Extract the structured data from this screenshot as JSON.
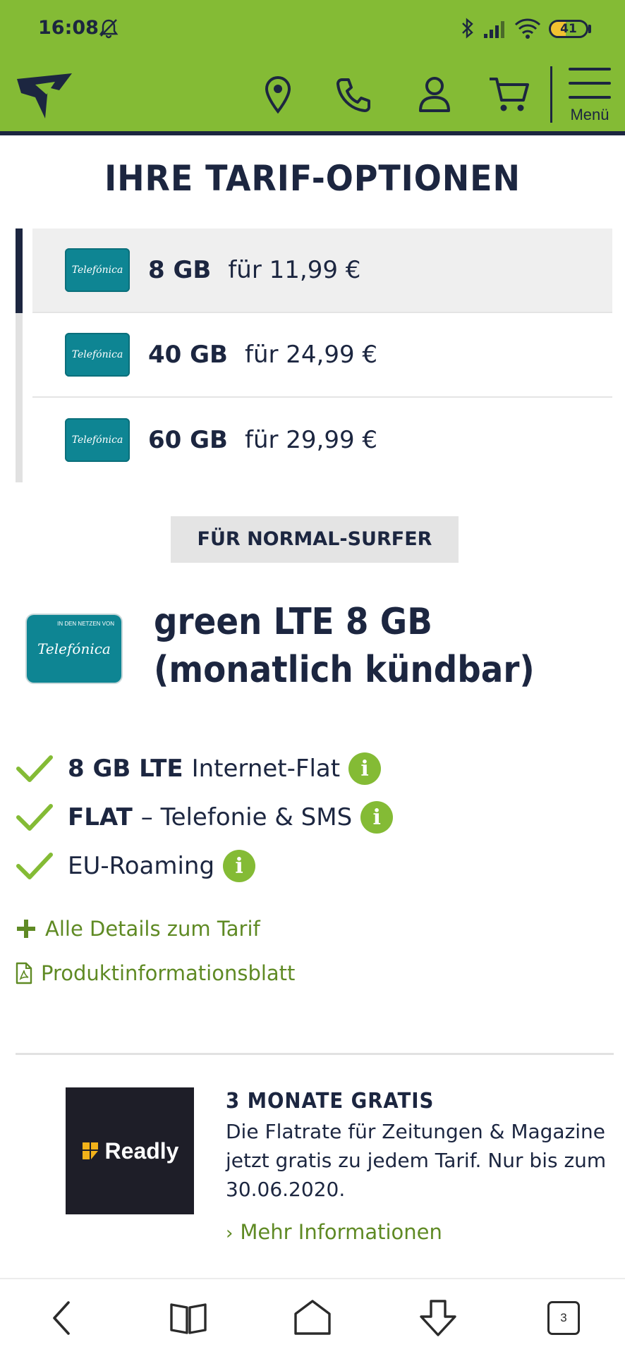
{
  "status_bar": {
    "time": "16:08",
    "battery_level": "41",
    "battery_fraction": 0.41,
    "icons": [
      "bell-muted-icon",
      "bluetooth-icon",
      "signal-icon",
      "wifi-icon",
      "battery-icon"
    ]
  },
  "header": {
    "brand_color": "#84bb35",
    "dark_color": "#1c2640",
    "menu_label": "Menü",
    "icons": [
      "location-icon",
      "phone-icon",
      "user-icon",
      "cart-icon",
      "menu-icon"
    ]
  },
  "section_title": "IHRE TARIF-OPTIONEN",
  "options": [
    {
      "badge": "Telefónica",
      "gb": "8 GB",
      "price": "für 11,99 €",
      "selected": true
    },
    {
      "badge": "Telefónica",
      "gb": "40 GB",
      "price": "für 24,99 €",
      "selected": false
    },
    {
      "badge": "Telefónica",
      "gb": "60 GB",
      "price": "für 29,99 €",
      "selected": false
    }
  ],
  "surfer_label": "FÜR NORMAL-SURFER",
  "product": {
    "logo_small": "IN DEN NETZEN VON",
    "logo_big": "Telefónica",
    "title_line1": "green LTE 8 GB",
    "title_line2": "(monatlich kündbar)"
  },
  "features": [
    {
      "bold": "8 GB LTE",
      "text": "Internet-Flat"
    },
    {
      "bold": "FLAT",
      "text": "– Telefonie & SMS"
    },
    {
      "bold": "",
      "text": "EU-Roaming"
    }
  ],
  "links": {
    "details": "Alle Details zum Tarif",
    "pib": "Produktinformationsblatt"
  },
  "promo": {
    "logo_text": "Readly",
    "title": "3 MONATE GRATIS",
    "text": "Die Flatrate für Zeitungen & Magazine jetzt gratis zu jedem Tarif. Nur bis zum 30.06.2020.",
    "link": "Mehr Informationen"
  },
  "bottom_nav": {
    "tabs_count": "3",
    "icons": [
      "back-icon",
      "bookmarks-icon",
      "home-icon",
      "download-icon",
      "tabs-icon"
    ]
  }
}
